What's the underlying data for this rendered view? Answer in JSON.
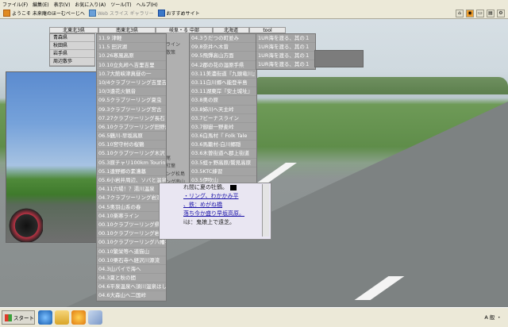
{
  "menubar": {
    "items": [
      "ファイル(F)",
      "編集(E)",
      "表示(V)",
      "お気に入り(A)",
      "ツール(T)",
      "ヘルプ(H)"
    ]
  },
  "links": {
    "items": [
      {
        "label": "ようこそ 未来庵のほーむぺーじへ",
        "dim": false
      },
      {
        "label": "Web スライス ギャラリー",
        "dim": true
      },
      {
        "label": "おすすめサイト",
        "dim": false
      }
    ]
  },
  "nav": {
    "tabs": [
      "北東北3県",
      "南東北3県",
      "岐阜・る 中部",
      "北海道",
      "tool"
    ]
  },
  "prefs": {
    "items": [
      "青森県",
      "秋田県",
      "岩手県",
      "周辺散歩"
    ]
  },
  "menu1": {
    "items": [
      "11.9  津軽",
      "11.5  田沢湖",
      "10.26寒風高原",
      "10.10立丸峠へ吉里吉里",
      "10.7大館峡津真昼の一",
      "10/4クラブツーリング吉里吉里",
      "10/3遠花火観音",
      "09.5クラブツーリング夏虫",
      "09.3クラブツーリング宮古",
      "07.27クラブツーリング長石",
      "06.10クラブツーリング田野畑",
      "06.5鶴川-早坂高原",
      "05.10宮守村の桜鶴",
      "05.10クラブツーリング木沢",
      "05.3原チャリ100km Touring",
      "05.1遠野郷の素漕墓",
      "05.6小岩井周辺、ソバと温泉",
      "04.11穴場！？湯川温泉",
      "04.7クラブツーリング岩洞湖",
      "04.5奥羽山系の春",
      "04.10楽寒ライン",
      "00.10クラブツーリング県地峰越",
      "00.10クラブツーリング岩手一周",
      "00.10クラブツーリング八幡平",
      "00.10繁栄等へ道猫山",
      "00.10栗石寺へ経沢川源流",
      "04.3山パイで海へ",
      "04.3夏と秋の間",
      "04.6平泉温泉へ須川温泉はしご",
      "04.6大森山へ二国峠"
    ]
  },
  "menu2": {
    "items": [
      "04.3うだつの町並み",
      "09.8奈井へ木曾",
      "09.5飛彈高山方面",
      "04.2郡の花の湿原手県",
      "03.11美濃街道『九頭竜川』",
      "03.11白川郷へ能登半島",
      "03.11湖東岸『安土城址』",
      "03.8奥の原",
      "03.8姉川へ天主峠",
      "03.7ビーナスライン",
      "03.7御嶽一野麦峠",
      "03.6白馬村『 Folk Tale",
      "03.6馬籠村-白川郷隠",
      "03.6木曽街道へ郡上街道",
      "03.5蛭ヶ野高原/鷲見高原",
      "03.5KTC練習",
      "03.5伊吹山",
      "03.4飛騨路の春"
    ]
  },
  "menu3": {
    "items": [
      "1UR海を渡る、其の１",
      "1UR海を渡る、其の１",
      "1UR海を渡る、其の１",
      "1UR海を渡る、其の１"
    ]
  },
  "midpanel": {
    "items": [
      "",
      "ライン",
      "散策",
      "",
      "",
      "",
      "",
      "",
      "",
      "",
      "",
      "",
      "",
      "",
      "",
      "尾",
      "紅葉",
      "ング松島",
      "ング南山",
      "",
      "ング蔵王",
      "ング温泉"
    ]
  },
  "content": {
    "line1": "れ間に夏の牡鶴。",
    "line2": "・リング、わかかみ平",
    "line3": "、鉄：めがね橋",
    "line4": "落ち今か盛り早坂高原。",
    "line5": "iは：鬼娘上で遠芝。"
  },
  "taskbar": {
    "start": "スタート",
    "tray_text": "A 般 ・"
  },
  "colors": {
    "menu_bg": "#a4a4a4",
    "link_blue": "#1a12a8"
  }
}
